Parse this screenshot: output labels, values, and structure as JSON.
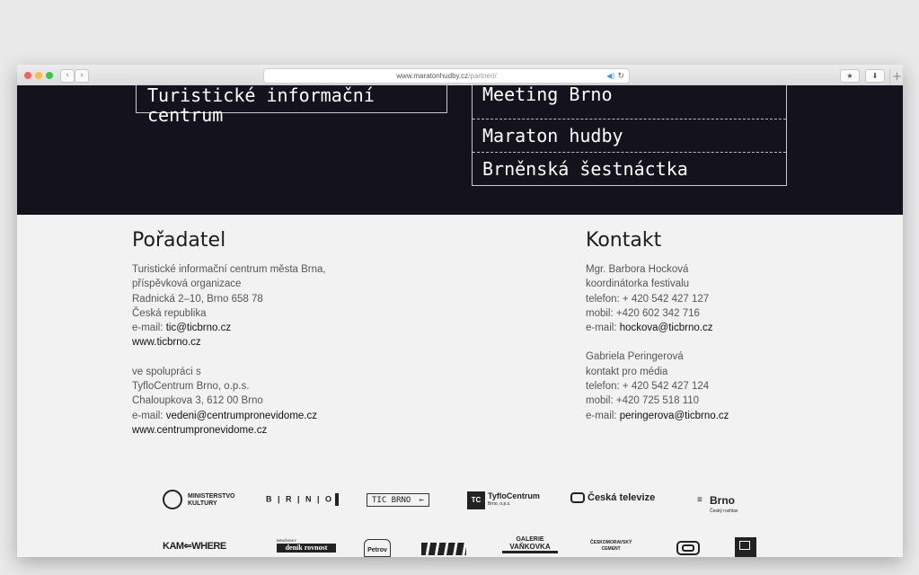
{
  "browser": {
    "url_domain": "www.maratonhudby.cz",
    "url_path": "/partneri/",
    "back_icon": "chevron-left-icon",
    "forward_icon": "chevron-right-icon"
  },
  "dark_section": {
    "box_left": "Turistické informační centrum",
    "box_right": [
      "Meeting Brno",
      "Maraton hudby",
      "Brněnská šestnáctka"
    ]
  },
  "poradatel": {
    "heading": "Pořadatel",
    "line1": "Turistické informační centrum města Brna,",
    "line2": "příspěvková organizace",
    "line3": "Radnická 2–10, Brno 658 78",
    "line4": "Česká republika",
    "email_label": "e-mail:",
    "email": "tic@ticbrno.cz",
    "web": "www.ticbrno.cz",
    "coop": "ve spolupráci s",
    "coop1": "TyfloCentrum Brno, o.p.s.",
    "coop2": "Chaloupkova 3, 612 00 Brno",
    "coop_email_label": "e-mail:",
    "coop_email": "vedeni@centrumpronevidome.cz",
    "coop_web": "www.centrumpronevidome.cz"
  },
  "kontakt": {
    "heading": "Kontakt",
    "p1_name": "Mgr. Barbora Hocková",
    "p1_role": "koordinátorka festivalu",
    "p1_phone": "telefon: + 420 542 427 127",
    "p1_mobile": "mobil: +420 602 342 716",
    "email_label": "e-mail:",
    "p1_email": "hockova@ticbrno.cz",
    "p2_name": "Gabriela Peringerová",
    "p2_role": "kontakt pro média",
    "p2_phone": "telefon: + 420 542 427 124",
    "p2_mobile": "mobil: +420 725 518 110",
    "p2_email": "peringerova@ticbrno.cz"
  },
  "logos": {
    "mk1": "MINISTERSTVO",
    "mk2": "KULTURY",
    "brno": "B | R | N | O",
    "tic": "TIC BRNO",
    "tyflo": "TyfloCentrum",
    "tyflo_sub": "Brno, o.p.s.",
    "ct": "Česká televize",
    "cro": "Brno",
    "cro_sub": "Český rozhlas",
    "kamewhere": "KAM⇐WHERE",
    "rovnost_top": "BRNĚNSKÝ",
    "rovnost": "deník rovnost",
    "petrov": "Petrov",
    "galerie1": "GALERIE",
    "galerie2": "VAŇKOVKA",
    "cement1": "ČESKOMORAVSKÝ",
    "cement2": "CEMENT"
  }
}
